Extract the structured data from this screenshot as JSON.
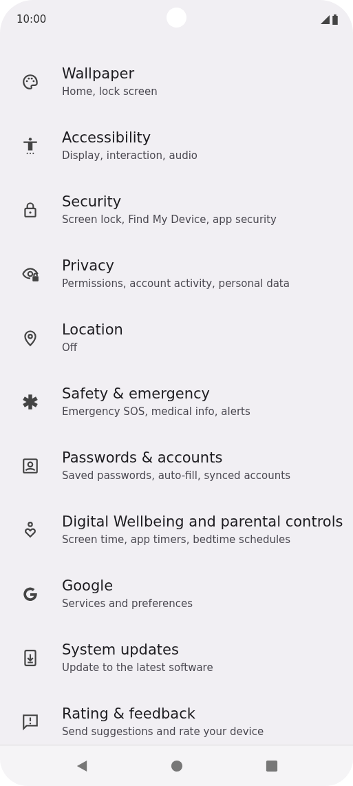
{
  "status_bar": {
    "time": "10:00"
  },
  "settings": [
    {
      "kind": "palette",
      "title": "Wallpaper",
      "subtitle": "Home, lock screen"
    },
    {
      "kind": "accessibility",
      "title": "Accessibility",
      "subtitle": "Display, interaction, audio"
    },
    {
      "kind": "lock",
      "title": "Security",
      "subtitle": "Screen lock, Find My Device, app security"
    },
    {
      "kind": "eye",
      "title": "Privacy",
      "subtitle": "Permissions, account activity, personal data"
    },
    {
      "kind": "pin",
      "title": "Location",
      "subtitle": "Off"
    },
    {
      "kind": "asterisk",
      "title": "Safety & emergency",
      "subtitle": "Emergency SOS, medical info, alerts"
    },
    {
      "kind": "badge",
      "title": "Passwords & accounts",
      "subtitle": "Saved passwords, auto-fill, synced accounts"
    },
    {
      "kind": "heart",
      "title": "Digital Wellbeing and parental controls",
      "subtitle": "Screen time, app timers, bedtime schedules"
    },
    {
      "kind": "google",
      "title": "Google",
      "subtitle": "Services and preferences"
    },
    {
      "kind": "update",
      "title": "System updates",
      "subtitle": "Update to the latest software"
    },
    {
      "kind": "feedback",
      "title": "Rating & feedback",
      "subtitle": "Send suggestions and rate your device"
    }
  ]
}
